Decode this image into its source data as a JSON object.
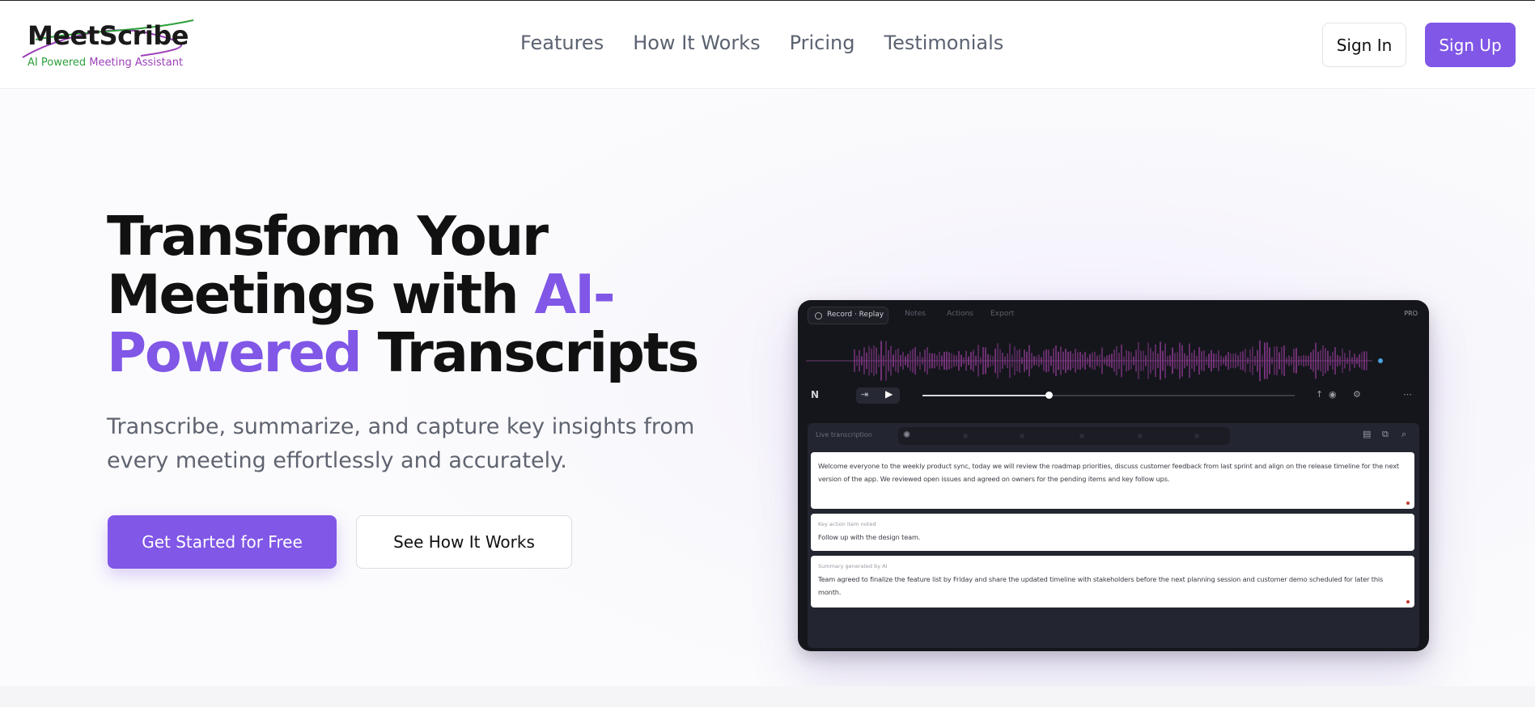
{
  "brand": {
    "name": "MeetScribe",
    "tagline_part1": "AI Powered",
    "tagline_part2": "Meeting Assistant"
  },
  "nav": {
    "links": [
      "Features",
      "How It Works",
      "Pricing",
      "Testimonials"
    ],
    "sign_in": "Sign In",
    "sign_up": "Sign Up"
  },
  "hero": {
    "headline_part1": "Transform Your Meetings with",
    "headline_accent": "AI-Powered",
    "headline_part2": "Transcripts",
    "subtitle": "Transcribe, summarize, and capture key insights from every meeting effortlessly and accurately.",
    "cta_primary": "Get Started for Free",
    "cta_secondary": "See How It Works"
  },
  "mockup": {
    "active_tab": "Record · Replay",
    "tabs": [
      "Notes",
      "Actions",
      "Export"
    ],
    "badge": "PRO",
    "playback_progress": 0.34,
    "panel_label": "Live transcription",
    "cards": [
      {
        "label": "",
        "text": "Welcome everyone to the weekly product sync, today we will review the roadmap priorities, discuss customer feedback from last sprint and align on the release timeline for the next version of the app. We reviewed open issues and agreed on owners for the pending items and key follow ups."
      },
      {
        "label": "Key action item noted",
        "text": "Follow up with the design team."
      },
      {
        "label": "Summary generated by AI",
        "text": "Team agreed to finalize the feature list by Friday and share the updated timeline with stakeholders before the next planning session and customer demo scheduled for later this month."
      }
    ]
  },
  "colors": {
    "accent": "#8057e6",
    "text_dark": "#111111",
    "text_muted": "#5f6470",
    "mock_bg": "#15161c",
    "wave": "#8b3a8f"
  }
}
